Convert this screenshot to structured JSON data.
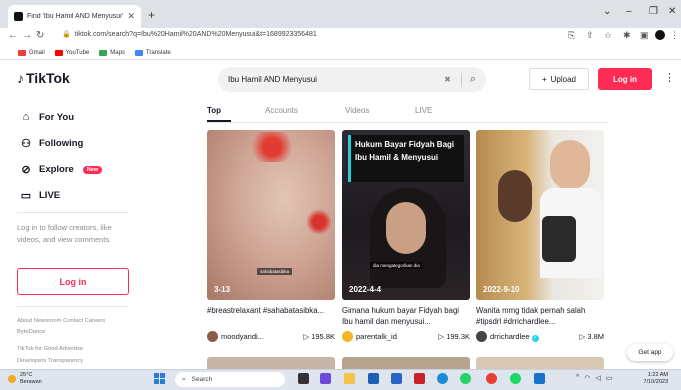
{
  "browser": {
    "tab_title": "Find 'Ibu Hamil AND Menyusui' o",
    "tab_close": "✕",
    "new_tab": "+",
    "url": "tiktok.com/search?q=Ibu%20Hamil%20AND%20Menyusui&t=1689923356481",
    "bookmarks": [
      {
        "label": "Gmail",
        "color": "#ea4335"
      },
      {
        "label": "YouTube",
        "color": "#ff0000"
      },
      {
        "label": "Maps",
        "color": "#34a853"
      },
      {
        "label": "Translate",
        "color": "#4285f4"
      }
    ]
  },
  "header": {
    "logo": "TikTok",
    "search_query": "Ibu Hamil AND Menyusui",
    "upload_label": "Upload",
    "login_label": "Log in"
  },
  "sidebar": {
    "items": [
      {
        "label": "For You",
        "icon": "home-icon"
      },
      {
        "label": "Following",
        "icon": "following-icon"
      },
      {
        "label": "Explore",
        "icon": "compass-icon",
        "badge": "New"
      },
      {
        "label": "LIVE",
        "icon": "live-icon"
      }
    ],
    "login_hint": "Log in to follow creators, like videos, and view comments.",
    "login_button": "Log in",
    "footer": [
      "About  Newsroom  Contact  Careers",
      "ByteDance",
      "TikTok for Good  Advertise",
      "Developers  Transparency"
    ]
  },
  "tabs": [
    "Top",
    "Accounts",
    "Videos",
    "LIVE"
  ],
  "videos": [
    {
      "date": "3-13",
      "caption": "#breastrelaxant #sahabatasibka...",
      "user": "moodyandi...",
      "views": "195.8K",
      "verified": false,
      "overlay": "sahabatasibka",
      "thumb_colors": [
        "#d8b9a7",
        "#c89784",
        "#e15a4f"
      ]
    },
    {
      "date": "2022-4-4",
      "caption": "Gimana hukum bayar Fidyah bagi Ibu hamil dan menyusui...",
      "user": "parentalk_id",
      "views": "199.3K",
      "verified": false,
      "title_overlay": "Hukum Bayar Fidyah Bagi Ibu Hamil & Menyusui",
      "overlay": "dia mengategorikan dia",
      "thumb_colors": [
        "#3d3037",
        "#1b1b1f",
        "#c7a58c"
      ]
    },
    {
      "date": "2022-9-10",
      "caption": "Wanita mmg tidak pernah salah #tipsdrl #drrichardlee...",
      "user": "drrichardlee",
      "views": "3.8M",
      "verified": true,
      "thumb_colors": [
        "#c99c57",
        "#f0ece6",
        "#222"
      ]
    }
  ],
  "get_app": "Get app",
  "taskbar": {
    "weather_temp": "25°C",
    "weather_desc": "Berawan",
    "search_placeholder": "Search",
    "time": "1:22 AM",
    "date": "7/10/2023"
  }
}
